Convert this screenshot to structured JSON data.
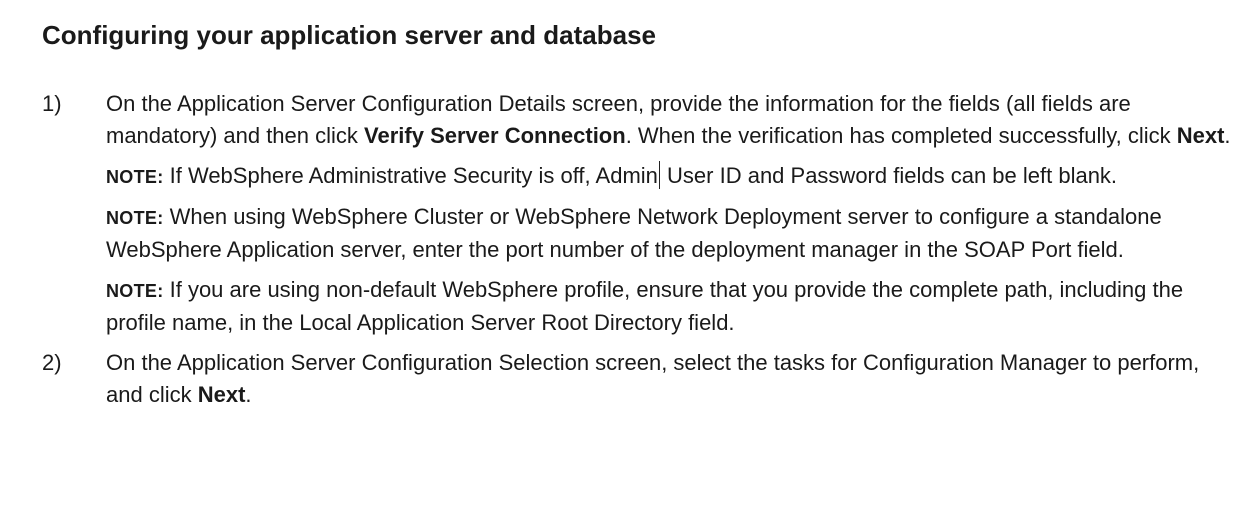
{
  "heading": "Configuring your application server and database",
  "steps": [
    {
      "number": "1)",
      "text_a": "On the Application Server Configuration Details screen, provide the information for the fields (all fields are mandatory) and then click ",
      "bold_a": "Verify Server Connection",
      "text_b": ". When the verification has completed successfully, click ",
      "bold_b": "Next",
      "text_c": ".",
      "notes": [
        {
          "label": "NOTE:",
          "text_a": " If WebSphere Administrative Security is off, Admin",
          "text_b": " User ID and Password fields can be left blank."
        },
        {
          "label": "NOTE:",
          "text": " When using WebSphere Cluster or WebSphere Network Deployment server to configure a standalone WebSphere Application server, enter the port number of the deployment manager in the SOAP Port field."
        },
        {
          "label": "NOTE:",
          "text": " If you are using non-default WebSphere profile, ensure that you provide the complete path, including the profile name, in the Local Application Server Root Directory field."
        }
      ]
    },
    {
      "number": "2)",
      "text_a": "On the Application Server Configuration Selection screen, select the tasks for Configuration Manager to perform, and click ",
      "bold_a": "Next",
      "text_b": "."
    }
  ]
}
